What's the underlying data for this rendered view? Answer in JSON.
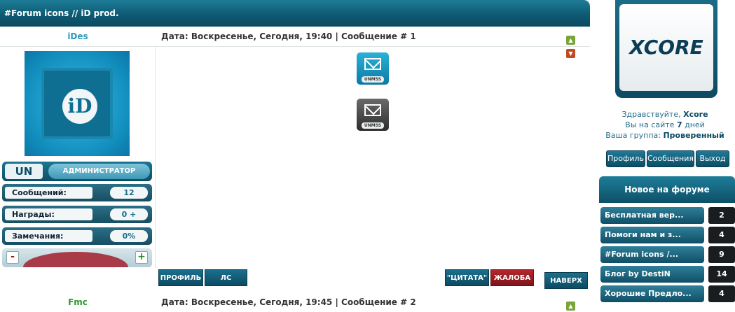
{
  "thread": {
    "title": "#Forum icons // iD prod."
  },
  "post1": {
    "author": "iDes",
    "author_color": "#2a9aba",
    "meta": "Дата: Воскресенье, Сегодня, 19:40 | Сообщение # 1",
    "rank_short": "UN",
    "role": "АДМИНИСТРАТОР",
    "avatar_text": "iD",
    "stats": [
      {
        "label": "Сообщений:",
        "value": "12"
      },
      {
        "label": "Награды:",
        "value": "0 +"
      },
      {
        "label": "Замечания:",
        "value": "0%"
      }
    ],
    "rep_minus": "-",
    "rep_plus": "+",
    "icon_tag": "UNMSS",
    "actions": {
      "profile": "ПРОФИЛЬ",
      "pm": "ЛС",
      "quote": "\"ЦИТАТА\"",
      "report": "ЖАЛОБА",
      "top": "НАВЕРХ"
    }
  },
  "post2": {
    "author": "Fmc",
    "author_color": "#2a9a2a",
    "meta": "Дата: Воскресенье, Сегодня, 19:45 | Сообщение # 2"
  },
  "sidebar": {
    "logo": "XCORE",
    "greeting": "Здравствуйте,",
    "username": "Xcore",
    "days_prefix": "Вы на сайте",
    "days": "7",
    "days_suffix": "дней",
    "group_prefix": "Ваша группа:",
    "group": "Проверенный",
    "buttons": {
      "profile": "Профиль",
      "messages": "Сообщения",
      "logout": "Выход"
    },
    "forum_title": "Новое на форуме",
    "forum_items": [
      {
        "title": "Бесплатная вер...",
        "count": "2"
      },
      {
        "title": "Помоги нам и з...",
        "count": "4"
      },
      {
        "title": "#Forum icons /...",
        "count": "9"
      },
      {
        "title": "Блог by DestiN",
        "count": "14"
      },
      {
        "title": "Хорошие Предло...",
        "count": "4"
      }
    ]
  }
}
